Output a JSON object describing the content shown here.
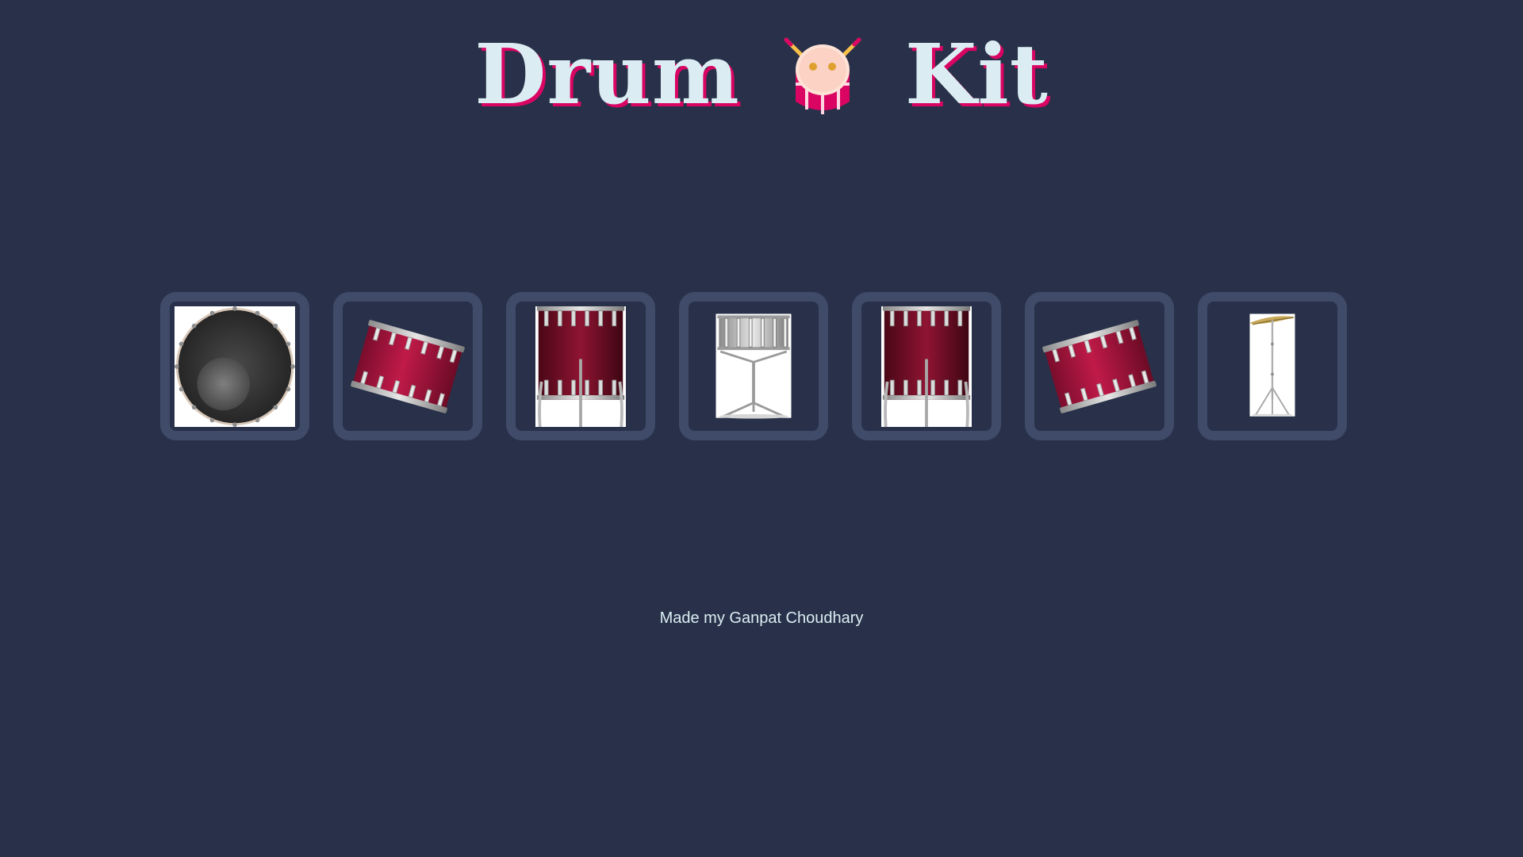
{
  "title": {
    "word1": "Drum",
    "word2": "Kit",
    "icon": "drum-emoji-icon"
  },
  "colors": {
    "background": "#283149",
    "button_border": "#404b69",
    "title_text": "#dbedf3",
    "title_shadow": "#da0463"
  },
  "drums": [
    {
      "icon": "bass-drum-icon"
    },
    {
      "icon": "tom-drum-icon"
    },
    {
      "icon": "floor-tom-icon"
    },
    {
      "icon": "snare-drum-icon"
    },
    {
      "icon": "floor-tom-icon"
    },
    {
      "icon": "tom-drum-icon"
    },
    {
      "icon": "cymbal-icon"
    }
  ],
  "footer": {
    "text": "Made my Ganpat Choudhary"
  }
}
